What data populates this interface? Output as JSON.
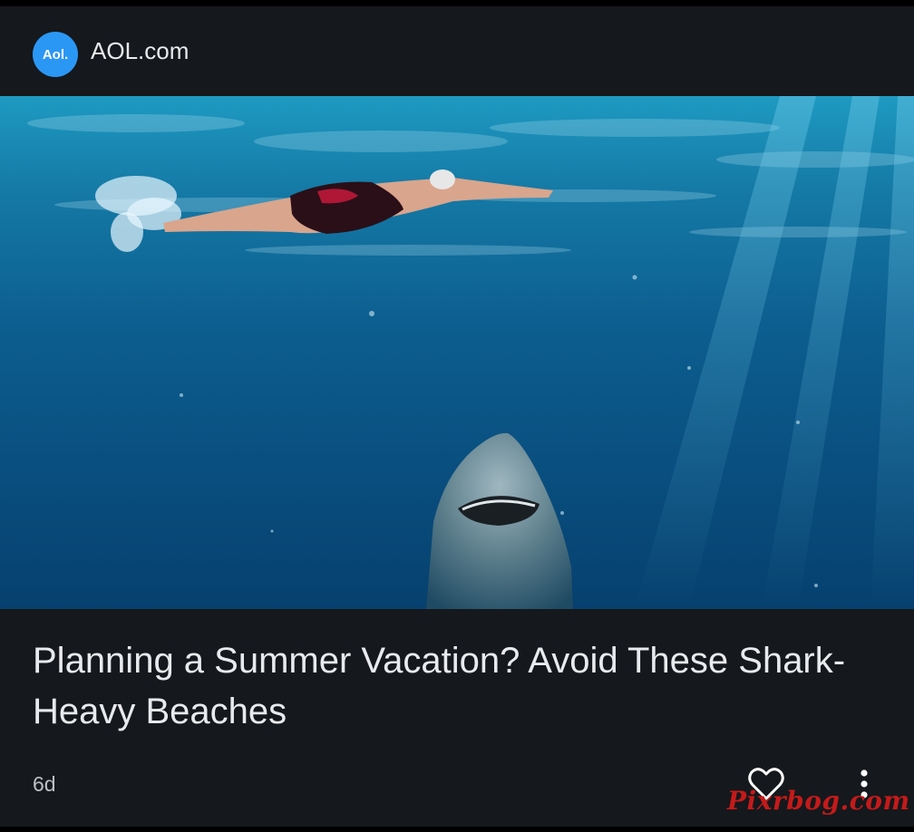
{
  "source": {
    "logo_text": "Aol.",
    "name": "AOL.com"
  },
  "article": {
    "headline": "Planning a Summer Vacation? Avoid These Shark-Heavy Beaches",
    "age": "6d",
    "image_description": "swimmer-above-shark-underwater-photo"
  },
  "actions": {
    "like_icon": "heart-outline-icon",
    "more_icon": "vertical-dots-icon"
  },
  "watermark": {
    "text": "Pixrbog.com"
  },
  "colors": {
    "card_background": "#15181c",
    "page_background": "#000000",
    "logo_background": "#2b97f5",
    "text_primary": "#e8eaed",
    "text_secondary": "#bdc1c6",
    "watermark": "#c41a1a"
  }
}
